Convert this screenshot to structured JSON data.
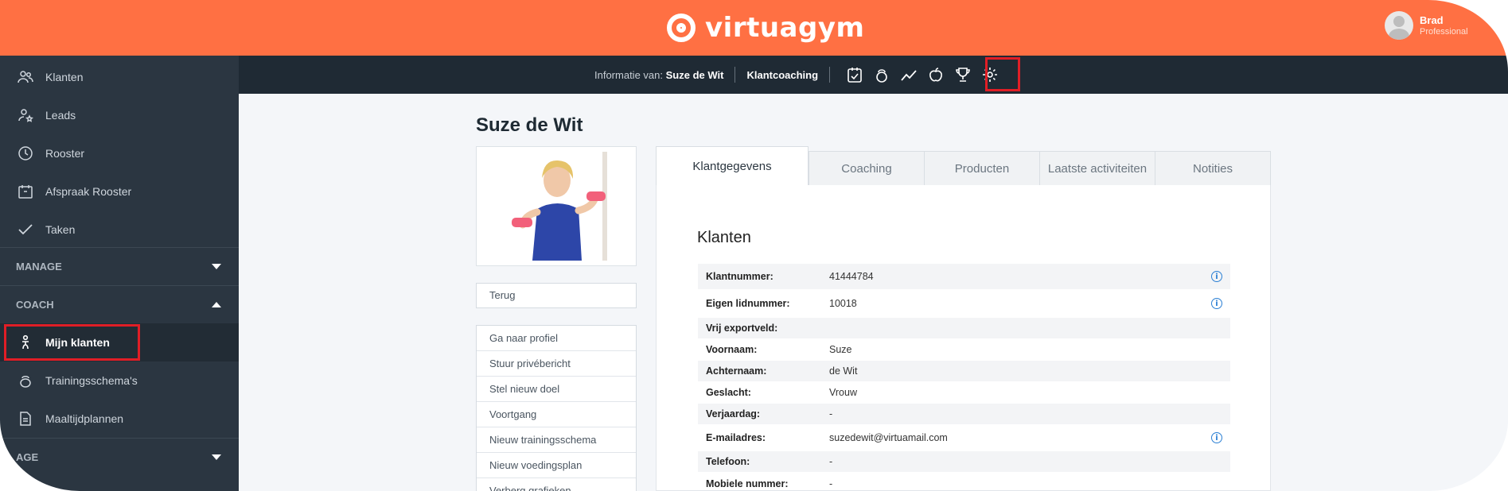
{
  "header": {
    "brand": "virtuagym",
    "user_name": "Brad",
    "user_role": "Professional"
  },
  "sidebar": {
    "items": [
      {
        "label": "Klanten",
        "icon": "users-icon"
      },
      {
        "label": "Leads",
        "icon": "user-star-icon"
      },
      {
        "label": "Rooster",
        "icon": "clock-icon"
      },
      {
        "label": "Afspraak Rooster",
        "icon": "calendar-icon"
      },
      {
        "label": "Taken",
        "icon": "check-icon"
      }
    ],
    "sections": [
      {
        "label": "MANAGE",
        "state": "collapsed"
      },
      {
        "label": "COACH",
        "state": "expanded"
      },
      {
        "label": "AGE",
        "state": "collapsed"
      }
    ],
    "coach_items": [
      {
        "label": "Mijn klanten",
        "icon": "person-icon",
        "active": true
      },
      {
        "label": "Trainingsschema's",
        "icon": "kettlebell-icon"
      },
      {
        "label": "Maaltijdplannen",
        "icon": "document-icon"
      }
    ]
  },
  "subnav": {
    "info_label": "Informatie van:",
    "client_name": "Suze de Wit",
    "coaching_label": "Klantcoaching",
    "icons": [
      "clipboard-check-icon",
      "kettlebell-icon",
      "chart-line-icon",
      "apple-icon",
      "trophy-icon",
      "gear-icon"
    ]
  },
  "client": {
    "name": "Suze de Wit",
    "back_label": "Terug",
    "actions": [
      "Ga naar profiel",
      "Stuur privébericht",
      "Stel nieuw doel",
      "Voortgang",
      "Nieuw trainingsschema",
      "Nieuw voedingsplan",
      "Verberg grafieken"
    ]
  },
  "tabs": [
    "Klantgegevens",
    "Coaching",
    "Producten",
    "Laatste activiteiten",
    "Notities"
  ],
  "details": {
    "title": "Klanten",
    "rows": [
      {
        "label": "Klantnummer:",
        "value": "41444784",
        "info": true
      },
      {
        "label": "Eigen lidnummer:",
        "value": "10018",
        "info": true
      },
      {
        "label": "Vrij exportveld:",
        "value": "",
        "info": false
      },
      {
        "label": "Voornaam:",
        "value": "Suze",
        "info": false
      },
      {
        "label": "Achternaam:",
        "value": "de Wit",
        "info": false
      },
      {
        "label": "Geslacht:",
        "value": "Vrouw",
        "info": false
      },
      {
        "label": "Verjaardag:",
        "value": "-",
        "info": false
      },
      {
        "label": "E-mailadres:",
        "value": "suzedewit@virtuamail.com",
        "info": true
      },
      {
        "label": "Telefoon:",
        "value": "-",
        "info": false
      },
      {
        "label": "Mobiele nummer:",
        "value": "-",
        "info": false
      }
    ]
  },
  "colors": {
    "brand": "#ff7043",
    "sidebar": "#2b3641",
    "highlight": "#e01e26",
    "info": "#2a7fd4"
  }
}
